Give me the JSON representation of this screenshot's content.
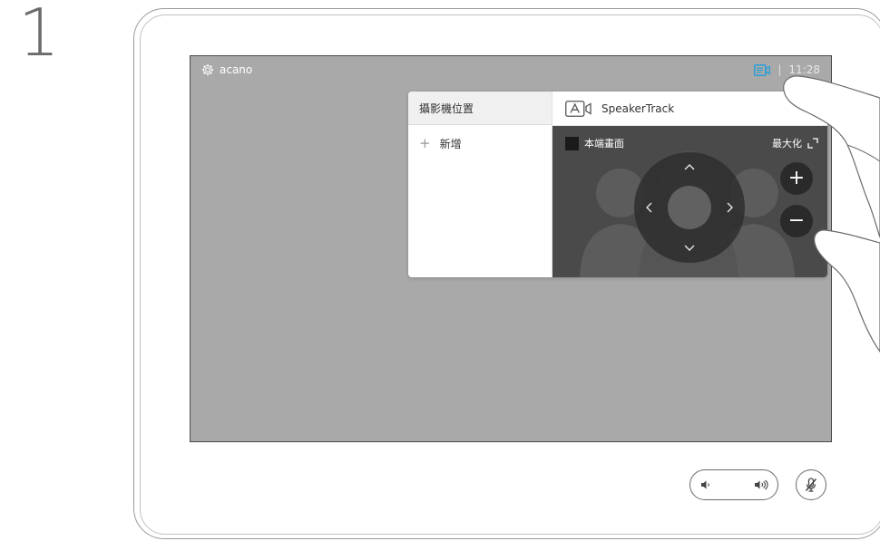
{
  "step_number": "1",
  "topbar": {
    "title": "acano",
    "time": "11:28",
    "separator": "|"
  },
  "camera_panel": {
    "presets_header": "攝影機位置",
    "add_preset_label": "新增",
    "speaker_track_label": "SpeakerTrack",
    "preview_label": "本端畫面",
    "maximize_label": "最大化",
    "zoom_in_symbol": "+",
    "zoom_out_symbol": "−"
  },
  "icons": {
    "settings": "gear-icon",
    "camera_control": "camera-control-icon",
    "speaker_track": "speaker-track-icon",
    "maximize": "maximize-icon",
    "volume_down": "volume-down-icon",
    "volume_up": "volume-up-icon",
    "mute": "microphone-muted-icon"
  },
  "colors": {
    "screen_background": "#a9a9a9",
    "preview_background": "#4a4a4a",
    "accent": "#2a9ed6",
    "panel_header": "#f0f0f0"
  }
}
